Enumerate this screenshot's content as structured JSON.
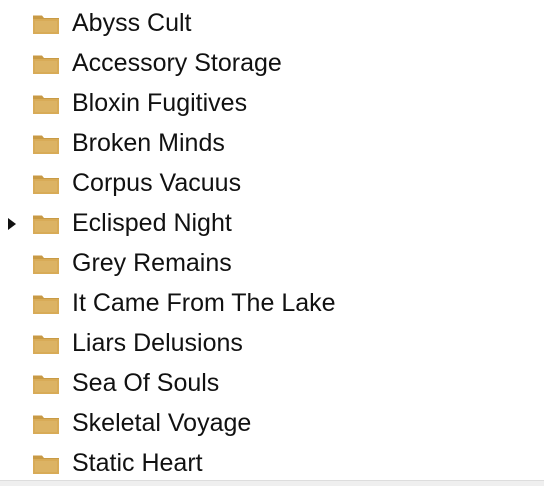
{
  "folders": [
    {
      "label": "Abyss Cult",
      "expandable": false
    },
    {
      "label": "Accessory Storage",
      "expandable": false
    },
    {
      "label": "Bloxin Fugitives",
      "expandable": false
    },
    {
      "label": "Broken Minds",
      "expandable": false
    },
    {
      "label": "Corpus Vacuus",
      "expandable": false
    },
    {
      "label": "Eclisped Night",
      "expandable": true
    },
    {
      "label": "Grey Remains",
      "expandable": false
    },
    {
      "label": "It Came From The Lake",
      "expandable": false
    },
    {
      "label": "Liars Delusions",
      "expandable": false
    },
    {
      "label": "Sea Of Souls",
      "expandable": false
    },
    {
      "label": "Skeletal Voyage",
      "expandable": false
    },
    {
      "label": "Static Heart",
      "expandable": false
    }
  ],
  "icons": {
    "folder": "folder-icon",
    "twisty": "triangle-right-icon"
  },
  "colors": {
    "folder_body": "#d8ab57",
    "folder_tab": "#c89a45",
    "folder_inner": "#e6c47d",
    "text": "#111111"
  }
}
